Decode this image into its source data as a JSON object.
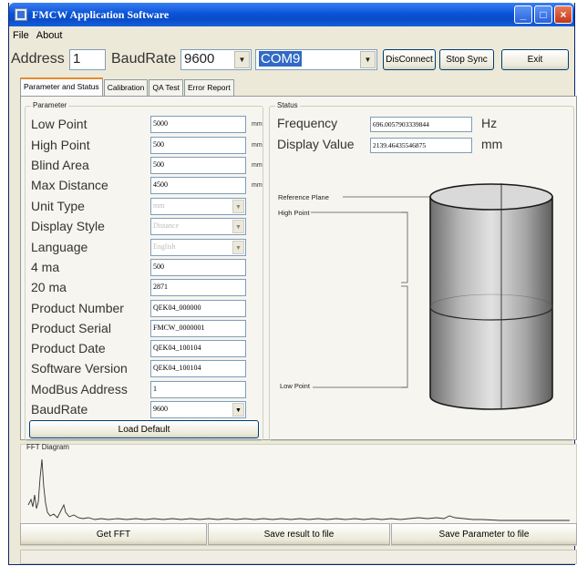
{
  "window": {
    "title": "FMCW Application Software"
  },
  "menu": [
    "File",
    "About"
  ],
  "connection": {
    "address_label": "Address",
    "address_value": "1",
    "baud_label": "BaudRate",
    "baud_value": "9600",
    "port_value": "COM9",
    "disconnect_label": "DisConnect",
    "stop_sync_label": "Stop Sync",
    "exit_label": "Exit"
  },
  "tabs": [
    "Parameter and Status",
    "Calibration",
    "QA Test",
    "Error Report"
  ],
  "parameter": {
    "group_title": "Parameter",
    "rows": [
      {
        "label": "Low Point",
        "value": "5000",
        "unit": "mm"
      },
      {
        "label": "High Point",
        "value": "500",
        "unit": "mm"
      },
      {
        "label": "Blind Area",
        "value": "500",
        "unit": "mm"
      },
      {
        "label": "Max Distance",
        "value": "4500",
        "unit": "mm"
      },
      {
        "label": "Unit Type",
        "value": "mm",
        "unit": ""
      },
      {
        "label": "Display Style",
        "value": "Distance",
        "unit": ""
      },
      {
        "label": "Language",
        "value": "English",
        "unit": ""
      },
      {
        "label": "4 ma",
        "value": "500",
        "unit": ""
      },
      {
        "label": "20 ma",
        "value": "2871",
        "unit": ""
      },
      {
        "label": "Product Number",
        "value": "QEK04_000000",
        "unit": ""
      },
      {
        "label": "Product Serial",
        "value": "FMCW_0000001",
        "unit": ""
      },
      {
        "label": "Product Date",
        "value": "QEK04_100104",
        "unit": ""
      },
      {
        "label": "Software Version",
        "value": "QEK04_100104",
        "unit": ""
      },
      {
        "label": "ModBus Address",
        "value": "1",
        "unit": ""
      },
      {
        "label": "BaudRate",
        "value": "9600",
        "unit": ""
      }
    ],
    "load_default_label": "Load Default"
  },
  "status": {
    "group_title": "Status",
    "frequency_label": "Frequency",
    "frequency_value": "696.0057903339844",
    "frequency_unit": "Hz",
    "display_label": "Display Value",
    "display_value": "2139.46435546875",
    "display_unit": "mm",
    "reference_plane_label": "Reference Plane",
    "high_point_label": "High Point",
    "low_point_label": "Low Point"
  },
  "fft": {
    "group_title": "FFT Diagram",
    "get_fft_label": "Get FFT",
    "save_result_label": "Save result to file",
    "save_param_label": "Save Parameter to file"
  },
  "colors": {
    "title_bar": "#0b54d8",
    "selected_port": "#316ac5",
    "window_bg": "#ece9d8"
  }
}
